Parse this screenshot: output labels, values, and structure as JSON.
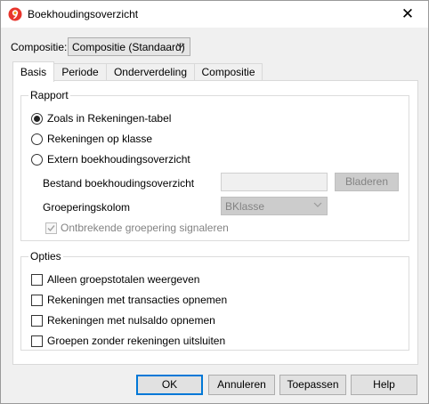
{
  "window": {
    "title": "Boekhoudingsoverzicht"
  },
  "composition": {
    "label": "Compositie:",
    "value": "Compositie (Standaard)"
  },
  "tabs": [
    {
      "label": "Basis",
      "active": true
    },
    {
      "label": "Periode",
      "active": false
    },
    {
      "label": "Onderverdeling",
      "active": false
    },
    {
      "label": "Compositie",
      "active": false
    }
  ],
  "report": {
    "title": "Rapport",
    "options": [
      {
        "label": "Zoals in Rekeningen-tabel",
        "selected": true
      },
      {
        "label": "Rekeningen op klasse",
        "selected": false
      },
      {
        "label": "Extern boekhoudingsoverzicht",
        "selected": false
      }
    ],
    "file_label": "Bestand boekhoudingsoverzicht",
    "file_value": "",
    "browse_label": "Bladeren",
    "group_column_label": "Groeperingskolom",
    "group_column_value": "BKlasse",
    "signal_missing_label": "Ontbrekende groepering signaleren",
    "signal_missing_checked": true
  },
  "options_group": {
    "title": "Opties",
    "items": [
      {
        "label": "Alleen groepstotalen weergeven",
        "checked": false
      },
      {
        "label": "Rekeningen met transacties opnemen",
        "checked": false
      },
      {
        "label": "Rekeningen met nulsaldo opnemen",
        "checked": false
      },
      {
        "label": "Groepen zonder rekeningen uitsluiten",
        "checked": false
      }
    ]
  },
  "buttons": {
    "ok": "OK",
    "cancel": "Annuleren",
    "apply": "Toepassen",
    "help": "Help"
  },
  "colors": {
    "accent": "#0078d7",
    "app_icon_red": "#e8352c",
    "app_icon_orange": "#f29a1f"
  }
}
